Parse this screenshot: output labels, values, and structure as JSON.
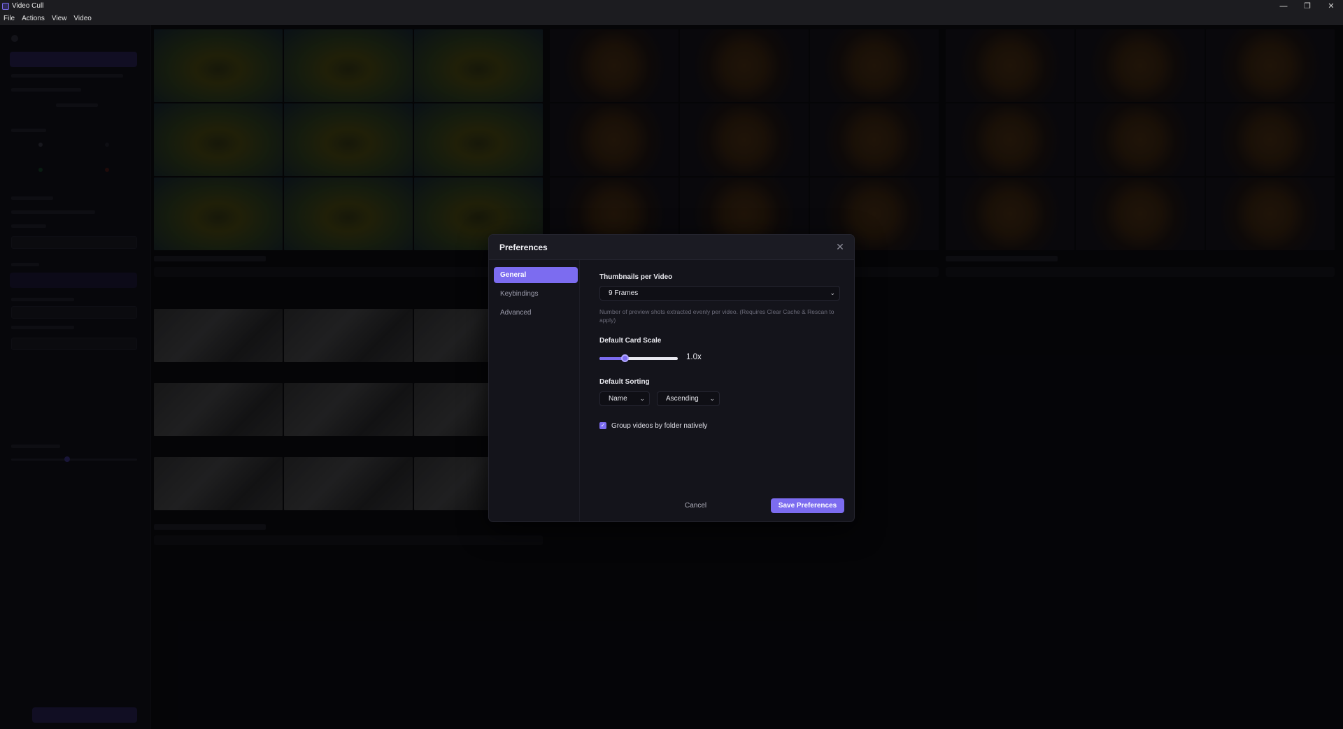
{
  "window": {
    "title": "Video Cull",
    "minimize_glyph": "—",
    "restore_glyph": "❐",
    "close_glyph": "✕"
  },
  "menu": {
    "items": [
      "File",
      "Actions",
      "View",
      "Video"
    ]
  },
  "dialog": {
    "title": "Preferences",
    "close_glyph": "✕",
    "nav": [
      {
        "label": "General",
        "active": true
      },
      {
        "label": "Keybindings",
        "active": false
      },
      {
        "label": "Advanced",
        "active": false
      }
    ],
    "thumbnails": {
      "label": "Thumbnails per Video",
      "value": "9 Frames",
      "help": "Number of preview shots extracted evenly per video. (Requires Clear Cache & Rescan to apply)"
    },
    "card_scale": {
      "label": "Default Card Scale",
      "value_text": "1.0x",
      "fraction": 0.33
    },
    "sorting": {
      "label": "Default Sorting",
      "field": "Name",
      "order": "Ascending"
    },
    "group_by_folder": {
      "label": "Group videos by folder natively",
      "checked": true
    },
    "buttons": {
      "cancel": "Cancel",
      "save": "Save Preferences"
    }
  },
  "colors": {
    "accent": "#7c6cf0",
    "dialog_bg": "#14141b",
    "app_bg": "#0a0a0e"
  }
}
